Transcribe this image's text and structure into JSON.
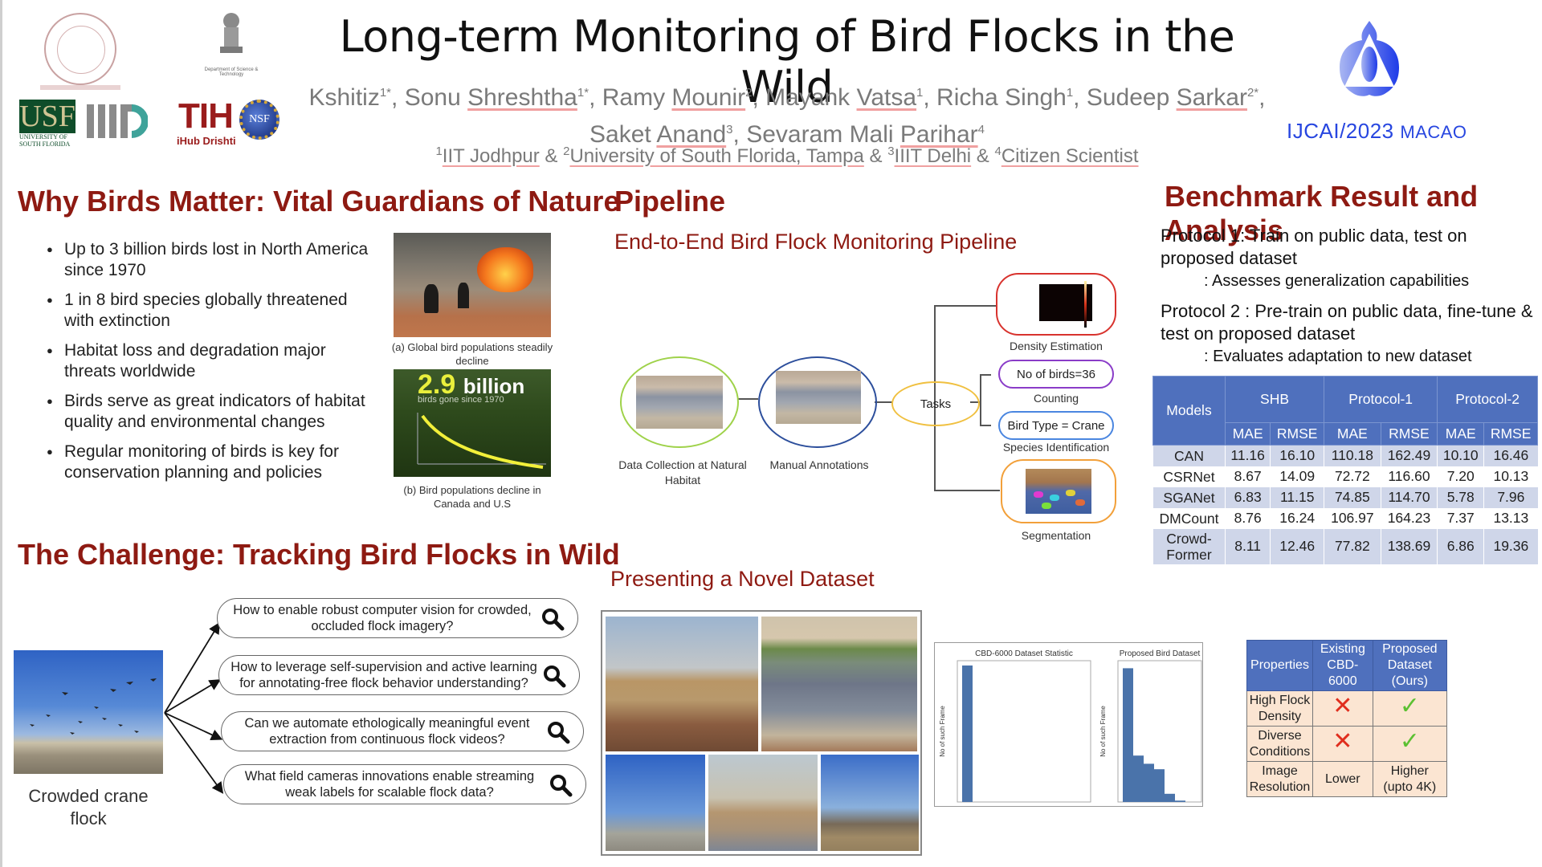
{
  "header": {
    "title": "Long-term Monitoring of Bird Flocks in the Wild",
    "authors_line1": [
      {
        "first": "Kshitiz",
        "last": "",
        "sup": "1*"
      },
      {
        "first": "Sonu ",
        "last": "Shreshtha",
        "sup": "1*"
      },
      {
        "first": "Ramy ",
        "last": "Mounir",
        "sup": "2"
      },
      {
        "first": "Mayank ",
        "last": "Vatsa",
        "sup": "1"
      },
      {
        "first": "Richa Singh",
        "last": "",
        "sup": "1"
      },
      {
        "first": "Sudeep ",
        "last": "Sarkar",
        "sup": "2*"
      }
    ],
    "authors_line2": [
      {
        "first": "Saket ",
        "last": "Anand",
        "sup": "3"
      },
      {
        "first": "Sevaram Mali ",
        "last": "Parihar",
        "sup": "4"
      }
    ],
    "affiliations": [
      {
        "sup": "1",
        "name": "IIT Jodhpur"
      },
      {
        "sup": "2",
        "name": "University of South Florida, Tampa"
      },
      {
        "sup": "3",
        "name": "IIIT Delhi"
      },
      {
        "sup": "4",
        "name": "Citizen Scientist"
      }
    ],
    "affiliation_separator": " & "
  },
  "logos": {
    "usf": "USF",
    "usf_sub": "UNIVERSITY OF SOUTH FLORIDA",
    "tih": "TIH",
    "tih_sub": "iHub Drishti",
    "nsf": "NSF",
    "dst_sub": "Department of Science & Technology",
    "ijcai_main": "IJCAI/2023",
    "ijcai_city": "MACAO"
  },
  "why_birds": {
    "title": "Why Birds Matter: Vital Guardians of Nature",
    "bullets": [
      "Up to 3 billion birds lost in North America since 1970",
      "1 in 8 bird species globally threatened with extinction",
      "Habitat loss and degradation major threats worldwide",
      "Birds serve as great indicators of habitat quality and environmental changes",
      "Regular monitoring of birds is key for conservation planning and policies"
    ],
    "figure_a_caption": "(a) Global bird populations steadily decline",
    "figure_b_caption": "(b) Bird populations decline in Canada and U.S",
    "figure_b_headline_number": "2.9",
    "figure_b_headline_word": "billion",
    "figure_b_subline": "birds gone since 1970"
  },
  "challenge": {
    "title": "The Challenge: Tracking Bird Flocks in Wild",
    "image_caption": "Crowded crane flock",
    "questions": [
      "How to enable robust computer vision for crowded, occluded flock imagery?",
      "How to leverage self-supervision and active learning for annotating-free flock behavior understanding?",
      "Can we automate ethologically meaningful event extraction from continuous flock videos?",
      "What field cameras innovations enable streaming weak labels for scalable flock data?"
    ]
  },
  "pipeline": {
    "title": "Pipeline",
    "subtitle": "End-to-End Bird Flock Monitoring Pipeline",
    "nodes": {
      "collection": "Data Collection at Natural Habitat",
      "annotation": "Manual Annotations",
      "tasks": "Tasks"
    },
    "tasks": [
      {
        "label": "Density Estimation",
        "pill": "",
        "color": "#d8332e"
      },
      {
        "label": "Counting",
        "pill": "No of birds=36",
        "color": "#8a3cc8"
      },
      {
        "label": "Species Identification",
        "pill": "Bird Type = Crane",
        "color": "#4a86e0"
      },
      {
        "label": "Segmentation",
        "pill": "",
        "color": "#f2a03a"
      }
    ],
    "node_colors": {
      "collection": "#9fd24a",
      "annotation": "#2d4f9c",
      "tasks": "#f0c040"
    }
  },
  "dataset": {
    "title": "Presenting a Novel Dataset",
    "histograms": [
      {
        "title": "CBD-6000 Dataset Statistic",
        "ylabel": "No of such Frame"
      },
      {
        "title": "Proposed Bird Dataset",
        "ylabel": "No of such Frame"
      }
    ],
    "properties_table": {
      "headers": [
        "Properties",
        "Existing CBD-6000",
        "Proposed Dataset (Ours)"
      ],
      "rows": [
        {
          "property": "High Flock Density",
          "existing": "cross",
          "proposed": "check"
        },
        {
          "property": "Diverse Conditions",
          "existing": "cross",
          "proposed": "check"
        },
        {
          "property": "Image Resolution",
          "existing": "Lower",
          "proposed": "Higher (upto 4K)"
        }
      ]
    }
  },
  "benchmark": {
    "title": "Benchmark Result and Analysis",
    "protocol1_label": "Protocol 1",
    "protocol1_text": ": Train on public data, test on proposed dataset",
    "protocol1_sub": ": Assesses generalization capabilities",
    "protocol2_label": "Protocol 2",
    "protocol2_text": " : Pre-train on public data, fine-tune & test on proposed dataset",
    "protocol2_sub": ": Evaluates adaptation to new dataset",
    "table": {
      "models_header": "Models",
      "groups": [
        "SHB",
        "Protocol-1",
        "Protocol-2"
      ],
      "metrics": [
        "MAE",
        "RMSE",
        "MAE",
        "RMSE",
        "MAE",
        "RMSE"
      ],
      "rows": [
        {
          "model": "CAN",
          "values": [
            "11.16",
            "16.10",
            "110.18",
            "162.49",
            "10.10",
            "16.46"
          ]
        },
        {
          "model": "CSRNet",
          "values": [
            "8.67",
            "14.09",
            "72.72",
            "116.60",
            "7.20",
            "10.13"
          ]
        },
        {
          "model": "SGANet",
          "values": [
            "6.83",
            "11.15",
            "74.85",
            "114.70",
            "5.78",
            "7.96"
          ]
        },
        {
          "model": "DMCount",
          "values": [
            "8.76",
            "16.24",
            "106.97",
            "164.23",
            "7.37",
            "13.13"
          ]
        },
        {
          "model": "Crowd-Former",
          "values": [
            "8.11",
            "12.46",
            "77.82",
            "138.69",
            "6.86",
            "19.36"
          ]
        }
      ]
    }
  }
}
